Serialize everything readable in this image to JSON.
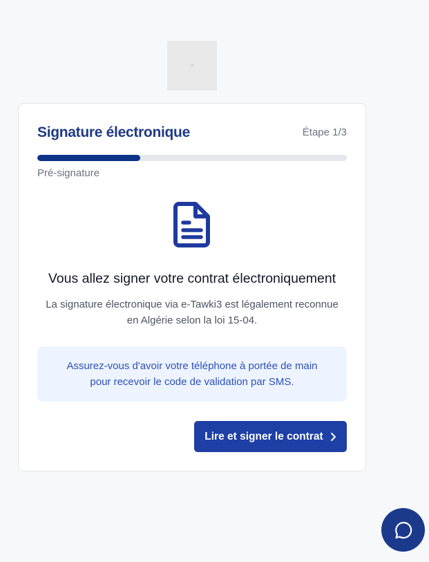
{
  "colors": {
    "brand": "#1f3a84",
    "progress_fill": "#0c3388",
    "button": "#1d3fa6",
    "notice_bg": "#edf4ff",
    "notice_text": "#2e4fb8"
  },
  "logo": {
    "icon": "logo-placeholder"
  },
  "card": {
    "title": "Signature électronique",
    "step_indicator": "Étape 1/3",
    "progress_fraction": 0.3333,
    "step_label": "Pré-signature",
    "icon": "document-icon",
    "headline": "Vous allez signer votre contrat électroniquement",
    "description_line1": "La signature électronique via e-Tawki3 est légalement reconnue",
    "description_line2": "en Algérie selon la loi 15-04.",
    "notice_line1": "Assurez-vous d'avoir votre téléphone à portée de main",
    "notice_line2": "pour recevoir le code de validation par SMS.",
    "cta_label": "Lire et signer le contrat",
    "cta_icon": "chevron-right-icon"
  },
  "chat": {
    "icon": "chat-bubble-icon"
  }
}
